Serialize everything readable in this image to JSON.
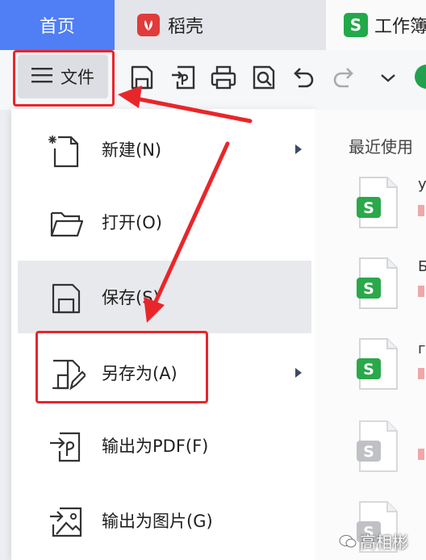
{
  "tabs": {
    "home": "首页",
    "docer": "稻壳",
    "sheet": "工作簿",
    "sheet_badge": "S"
  },
  "toolbar": {
    "file_label": "文件"
  },
  "menu": {
    "items": [
      {
        "label": "新建(N)",
        "icon": "new-file-icon",
        "submenu": true
      },
      {
        "label": "打开(O)",
        "icon": "folder-open-icon",
        "submenu": false
      },
      {
        "label": "保存(S)",
        "icon": "save-icon",
        "submenu": false
      },
      {
        "label": "另存为(A)",
        "icon": "save-as-icon",
        "submenu": true
      },
      {
        "label": "输出为PDF(F)",
        "icon": "export-pdf-icon",
        "submenu": false
      },
      {
        "label": "输出为图片(G)",
        "icon": "export-image-icon",
        "submenu": false
      }
    ]
  },
  "recent": {
    "title": "最近使用",
    "files": [
      {
        "badge": "S",
        "initial": "у"
      },
      {
        "badge": "S",
        "initial": "Б"
      },
      {
        "badge": "S",
        "initial": "г"
      },
      {
        "badge": "S",
        "initial": ""
      },
      {
        "badge": "S",
        "initial": ""
      }
    ]
  },
  "watermark": "高相彬",
  "colors": {
    "accent_blue": "#4f7ef5",
    "sheet_green": "#22a94a",
    "highlight_red": "#e8262a"
  }
}
